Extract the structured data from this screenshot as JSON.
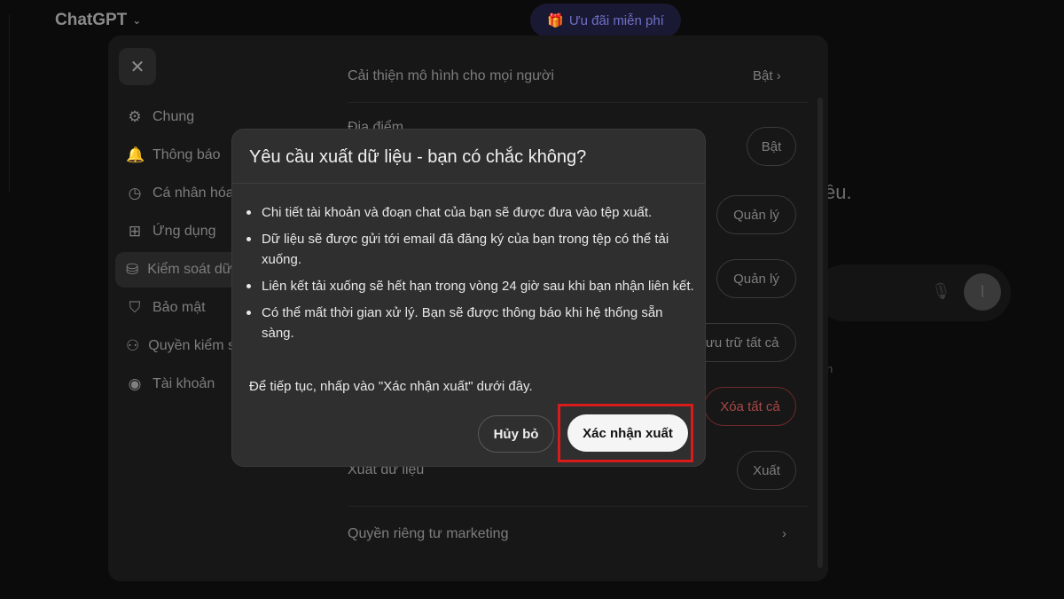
{
  "app": {
    "brand": "ChatGPT",
    "promo_label": "Ưu đãi miễn phí",
    "bg_heading_fragment": "ều.",
    "bg_small_fragment": "n"
  },
  "settings": {
    "sidebar": [
      {
        "label": "Chung",
        "icon": "gear-icon"
      },
      {
        "label": "Thông báo",
        "icon": "bell-icon"
      },
      {
        "label": "Cá nhân hóa",
        "icon": "clock-icon"
      },
      {
        "label": "Ứng dụng",
        "icon": "grid-icon"
      },
      {
        "label": "Kiểm soát dữ liệu",
        "icon": "database-icon",
        "active": true
      },
      {
        "label": "Bảo mật",
        "icon": "shield-icon"
      },
      {
        "label": "Quyền kiểm soát",
        "icon": "person-icon"
      },
      {
        "label": "Tài khoản",
        "icon": "account-icon"
      }
    ],
    "rows": {
      "improve_model": {
        "label": "Cải thiện mô hình cho mọi người",
        "value": "Bật"
      },
      "location": {
        "label": "Địa điểm",
        "action": "Bật"
      },
      "manage1": {
        "action": "Quản lý"
      },
      "manage2": {
        "action": "Quản lý"
      },
      "archive_all": {
        "action": "Lưu trữ tất cả"
      },
      "delete_all": {
        "action": "Xóa tất cả"
      },
      "export": {
        "label": "Xuất dữ liệu",
        "action": "Xuất"
      },
      "marketing": {
        "label": "Quyền riêng tư marketing"
      }
    }
  },
  "dialog": {
    "title": "Yêu cầu xuất dữ liệu - bạn có chắc không?",
    "bullets": [
      "Chi tiết tài khoản và đoạn chat của bạn sẽ được đưa vào tệp xuất.",
      "Dữ liệu sẽ được gửi tới email đã đăng ký của bạn trong tệp có thể tải xuống.",
      "Liên kết tải xuống sẽ hết hạn trong vòng 24 giờ sau khi bạn nhận liên kết.",
      "Có thể mất thời gian xử lý. Bạn sẽ được thông báo khi hệ thống sẵn sàng."
    ],
    "note": "Để tiếp tục, nhấp vào \"Xác nhận xuất\" dưới đây.",
    "cancel_label": "Hủy bỏ",
    "confirm_label": "Xác nhận xuất"
  },
  "colors": {
    "highlight": "#d81b1b",
    "dialog_bg": "#2f2f2f",
    "panel_bg": "#171717",
    "danger": "#a84848"
  }
}
